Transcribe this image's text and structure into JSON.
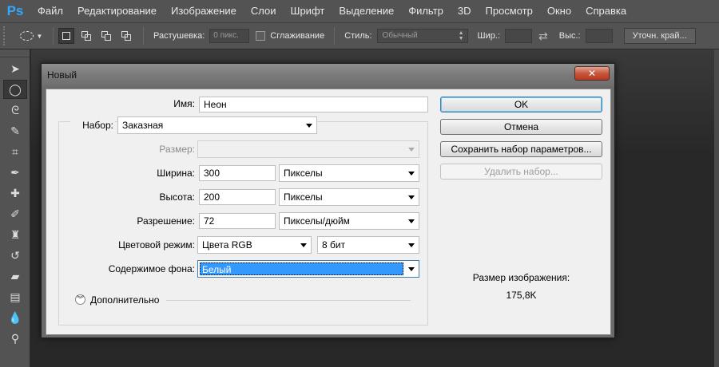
{
  "app": {
    "logo": "Ps"
  },
  "menu": [
    "Файл",
    "Редактирование",
    "Изображение",
    "Слои",
    "Шрифт",
    "Выделение",
    "Фильтр",
    "3D",
    "Просмотр",
    "Окно",
    "Справка"
  ],
  "options": {
    "feather_label": "Растушевка:",
    "feather_value": "0 пикс.",
    "antialias_label": "Сглаживание",
    "style_label": "Стиль:",
    "style_value": "Обычный",
    "width_label": "Шир.:",
    "height_label": "Выс.:",
    "refine_edge": "Уточн. край..."
  },
  "dialog": {
    "title": "Новый",
    "close": "✕",
    "name_label": "Имя:",
    "name_value": "Неон",
    "preset_label": "Набор:",
    "preset_value": "Заказная",
    "size_label": "Размер:",
    "size_value": "",
    "width_label": "Ширина:",
    "width_value": "300",
    "width_unit": "Пикселы",
    "height_label": "Высота:",
    "height_value": "200",
    "height_unit": "Пикселы",
    "resolution_label": "Разрешение:",
    "resolution_value": "72",
    "resolution_unit": "Пикселы/дюйм",
    "color_mode_label": "Цветовой режим:",
    "color_mode_value": "Цвета RGB",
    "bit_depth_value": "8 бит",
    "background_label": "Содержимое фона:",
    "background_value": "Белый",
    "advanced_label": "Дополнительно",
    "ok_button": "OK",
    "cancel_button": "Отмена",
    "save_preset_button": "Сохранить набор параметров...",
    "delete_preset_button": "Удалить набор...",
    "image_size_label": "Размер изображения:",
    "image_size_value": "175,8K"
  },
  "colors": {
    "accent": "#3399ff",
    "ps_blue": "#31a8ff",
    "close_red": "#c9573d"
  }
}
